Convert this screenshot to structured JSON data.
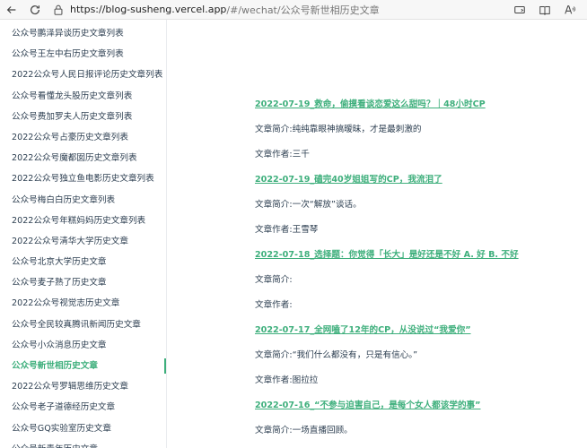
{
  "browser": {
    "url_host": "https://blog-susheng.vercel.app",
    "url_rest": "/#/wechat/公众号新世相历史文章"
  },
  "sidebar": {
    "items": [
      {
        "label": "公众号鹏泽异谈历史文章列表",
        "active": false
      },
      {
        "label": "公众号王左中右历史文章列表",
        "active": false
      },
      {
        "label": "2022公众号人民日报评论历史文章列表",
        "active": false
      },
      {
        "label": "公众号看懂龙头股历史文章列表",
        "active": false
      },
      {
        "label": "公众号费加罗夫人历史文章列表",
        "active": false
      },
      {
        "label": "2022公众号占豪历史文章列表",
        "active": false
      },
      {
        "label": "2022公众号魔都囡历史文章列表",
        "active": false
      },
      {
        "label": "2022公众号独立鱼电影历史文章列表",
        "active": false
      },
      {
        "label": "公众号梅白白历史文章列表",
        "active": false
      },
      {
        "label": "2022公众号年糕妈妈历史文章列表",
        "active": false
      },
      {
        "label": "2022公众号清华大学历史文章",
        "active": false
      },
      {
        "label": "公众号北京大学历史文章",
        "active": false
      },
      {
        "label": "公众号麦子熟了历史文章",
        "active": false
      },
      {
        "label": "2022公众号视觉志历史文章",
        "active": false
      },
      {
        "label": "公众号全民较真腾讯新闻历史文章",
        "active": false
      },
      {
        "label": "公众号小众消息历史文章",
        "active": false
      },
      {
        "label": "公众号新世相历史文章",
        "active": true
      },
      {
        "label": "2022公众号罗辑思维历史文章",
        "active": false
      },
      {
        "label": "公众号老子道德经历史文章",
        "active": false
      },
      {
        "label": "公众号GQ实验室历史文章",
        "active": false
      },
      {
        "label": "公众号新青年历史文章",
        "active": false
      }
    ]
  },
  "articles": [
    {
      "title": "2022-07-19_救命，偷摸看谈恋爱这么甜吗？｜48小时CP",
      "summary": "文章简介:纯纯靠眼神搞暧昧，才是最刺激的",
      "author": "文章作者:三千"
    },
    {
      "title": "2022-07-19_磕完40岁姐姐写的CP，我流泪了",
      "summary": "文章简介:一次“解放”谈话。",
      "author": "文章作者:王雪琴"
    },
    {
      "title": "2022-07-18_选择题：你觉得「长大」是好还是不好 A. 好 B. 不好",
      "summary": "文章简介:",
      "author": "文章作者:"
    },
    {
      "title": "2022-07-17_全网嗑了12年的CP，从没说过“我爱你”",
      "summary": "文章简介:“我们什么都没有，只是有信心。”",
      "author": "文章作者:图拉拉"
    },
    {
      "title": "2022-07-16_“不参与迫害自己，是每个女人都该学的事”",
      "summary": "文章简介:一场直播回顾。",
      "author": ""
    }
  ]
}
